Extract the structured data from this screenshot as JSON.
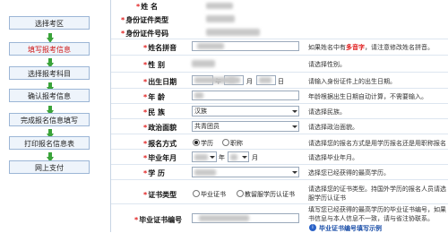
{
  "sidebar": {
    "steps": [
      {
        "label": "选择考区"
      },
      {
        "label": "填写报考信息"
      },
      {
        "label": "选择报考科目"
      },
      {
        "label": "确认报考信息"
      },
      {
        "label": "完成报名信息填写"
      },
      {
        "label": "打印报名信息表"
      },
      {
        "label": "网上支付"
      }
    ]
  },
  "form": {
    "name_label": "姓 名",
    "id_type_label": "身份证件类型",
    "id_no_label": "身份证件号码",
    "pinyin": {
      "label": "姓名拼音",
      "hint_pre": "如果姓名中有",
      "hint_red": "多音字",
      "hint_post": "，请注意修改姓名拼音。"
    },
    "gender": {
      "label": "性 别",
      "hint": "请选择性别。"
    },
    "birth": {
      "label": "出生日期",
      "year": "年",
      "month": "月",
      "day": "日",
      "hint": "请输入身份证件上的出生日期。"
    },
    "age": {
      "label": "年 龄",
      "hint": "年龄根据出生日期自动计算，不需要输入。"
    },
    "ethnic": {
      "label": "民 族",
      "value": "汉族",
      "hint": "请选择民族。"
    },
    "politics": {
      "label": "政治面貌",
      "value": "共青团员",
      "hint": "请选择政治面貌。"
    },
    "mode": {
      "label": "报名方式",
      "opt1": "学历",
      "opt2": "职称",
      "hint": "请选择您的报名方式是用学历报名还是用职称报名"
    },
    "grad_year": {
      "label": "毕业年月",
      "year": "年",
      "month": "月",
      "hint": "请选择毕业年月。"
    },
    "education": {
      "label": "学 历",
      "hint": "选择您已经获得的最高学历。"
    },
    "cert_type": {
      "label": "证书类型",
      "opt1": "毕业证书",
      "opt2": "教留服学历认证书",
      "hint1": "请选择您的证书类型。持国外学历的报名人员请选",
      "hint2": "服学历认证书"
    },
    "cert_no": {
      "label": "毕业证书编号",
      "hint1": "填写您已经获得的最高学历的毕业证书编号，如果",
      "hint2": "书信息与本人信息不一致，请与省注协联系。",
      "link": "毕业证书编号填写示例"
    }
  }
}
